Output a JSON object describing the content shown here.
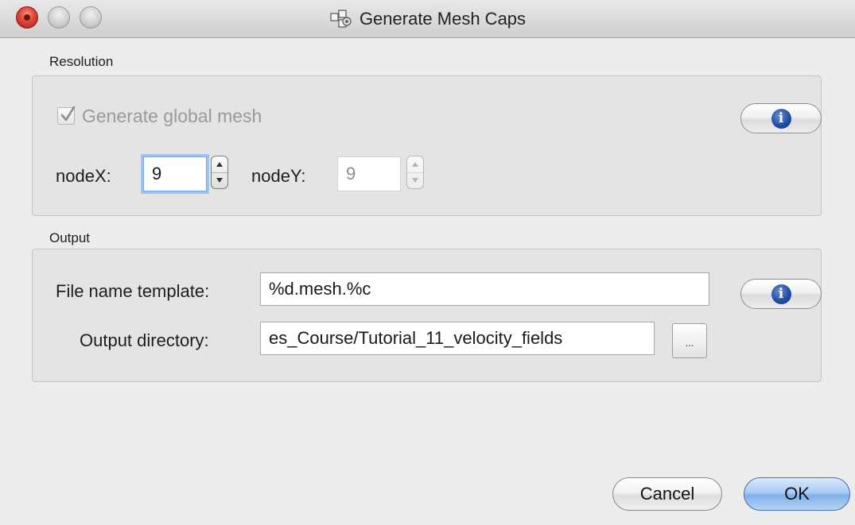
{
  "window": {
    "title": "Generate Mesh Caps"
  },
  "resolution": {
    "section_label": "Resolution",
    "generate_global_mesh": {
      "label": "Generate global mesh",
      "checked": true,
      "enabled": false
    },
    "nodeX": {
      "label": "nodeX:",
      "value": "9"
    },
    "nodeY": {
      "label": "nodeY:",
      "value": "9",
      "enabled": false
    },
    "info_icon": "info-icon"
  },
  "output": {
    "section_label": "Output",
    "file_name_template": {
      "label": "File name template:",
      "value": "%d.mesh.%c"
    },
    "output_directory": {
      "label": "Output directory:",
      "value": "es_Course/Tutorial_11_velocity_fields"
    },
    "browse_label": "...",
    "info_icon": "info-icon"
  },
  "buttons": {
    "cancel": "Cancel",
    "ok": "OK"
  },
  "colors": {
    "window_bg": "#ececec",
    "group_bg": "#e4e4e4",
    "focus_ring": "#9fc3f1",
    "default_button": "#7fb0ea",
    "close_button": "#e0443a"
  }
}
